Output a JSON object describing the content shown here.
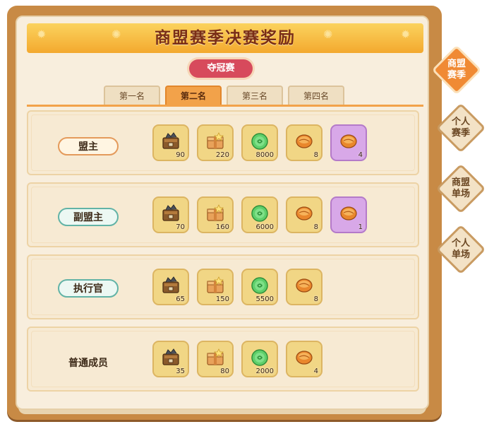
{
  "title": "商盟赛季决赛奖励",
  "ribbon": "夺冠赛",
  "tabs": [
    {
      "label": "第一名",
      "active": false
    },
    {
      "label": "第二名",
      "active": true
    },
    {
      "label": "第三名",
      "active": false
    },
    {
      "label": "第四名",
      "active": false
    }
  ],
  "side_tabs": [
    {
      "line1": "商盟",
      "line2": "赛季",
      "active": true
    },
    {
      "line1": "个人",
      "line2": "赛季",
      "active": false
    },
    {
      "line1": "商盟",
      "line2": "单场",
      "active": false
    },
    {
      "line1": "个人",
      "line2": "单场",
      "active": false
    }
  ],
  "rows": [
    {
      "role": "盟主",
      "role_style": "orange",
      "items": [
        {
          "icon": "crate-icon",
          "count": "90"
        },
        {
          "icon": "gift-box-icon",
          "count": "220"
        },
        {
          "icon": "jade-coin-icon",
          "count": "8000"
        },
        {
          "icon": "amber-stone-icon",
          "count": "8"
        },
        {
          "icon": "amber-stone-icon",
          "count": "4",
          "rare": true
        }
      ]
    },
    {
      "role": "副盟主",
      "role_style": "teal",
      "items": [
        {
          "icon": "crate-icon",
          "count": "70"
        },
        {
          "icon": "gift-box-icon",
          "count": "160"
        },
        {
          "icon": "jade-coin-icon",
          "count": "6000"
        },
        {
          "icon": "amber-stone-icon",
          "count": "8"
        },
        {
          "icon": "amber-stone-icon",
          "count": "1",
          "rare": true
        }
      ]
    },
    {
      "role": "执行官",
      "role_style": "teal",
      "items": [
        {
          "icon": "crate-icon",
          "count": "65"
        },
        {
          "icon": "gift-box-icon",
          "count": "150"
        },
        {
          "icon": "jade-coin-icon",
          "count": "5500"
        },
        {
          "icon": "amber-stone-icon",
          "count": "8"
        }
      ]
    },
    {
      "role": "普通成员",
      "role_style": "plain",
      "items": [
        {
          "icon": "crate-icon",
          "count": "35"
        },
        {
          "icon": "gift-box-icon",
          "count": "80"
        },
        {
          "icon": "jade-coin-icon",
          "count": "2000"
        },
        {
          "icon": "amber-stone-icon",
          "count": "4"
        }
      ]
    }
  ],
  "colors": {
    "accent": "#f2a24a",
    "board": "#c88a45",
    "paper": "#f8eedd",
    "ribbon": "#d74a5c"
  }
}
